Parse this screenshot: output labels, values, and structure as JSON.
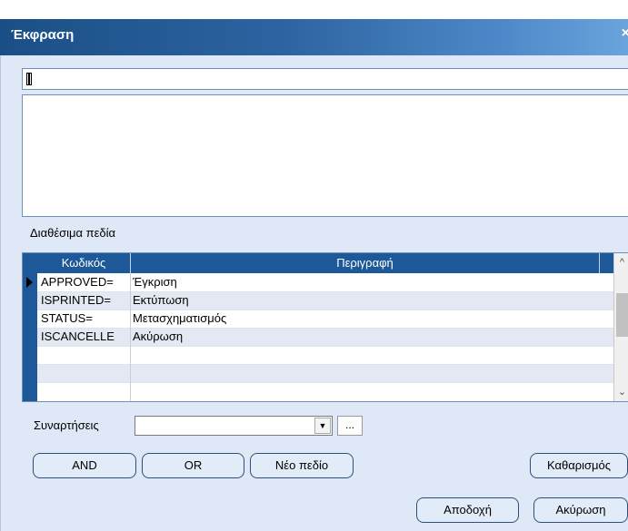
{
  "window": {
    "title": "Έκφραση",
    "close_glyph": "×"
  },
  "expression": {
    "value": ""
  },
  "memo": {
    "value": ""
  },
  "fields_label": "Διαθέσιμα πεδία",
  "grid": {
    "columns": [
      "Κωδικός",
      "Περιγραφή"
    ],
    "rows": [
      {
        "code": "APPROVED=",
        "desc": "Έγκριση"
      },
      {
        "code": "ISPRINTED=",
        "desc": "Εκτύπωση"
      },
      {
        "code": "STATUS=",
        "desc": "Μετασχηματισμός"
      },
      {
        "code": "ISCANCELLE",
        "desc": "Ακύρωση"
      }
    ],
    "scroll_up": "^",
    "scroll_down": "⌄"
  },
  "functions": {
    "label": "Συναρτήσεις",
    "value": "",
    "dropdown_glyph": "▼",
    "browse_label": "..."
  },
  "buttons": {
    "and": "AND",
    "or": "OR",
    "new_field": "Νέο πεδίο",
    "clear": "Καθαρισμός",
    "accept": "Αποδοχή",
    "cancel": "Ακύρωση"
  },
  "colors": {
    "titlebar": "#1d5898",
    "dialog_bg": "#dfe8f6",
    "grid_header": "#1d5898"
  }
}
